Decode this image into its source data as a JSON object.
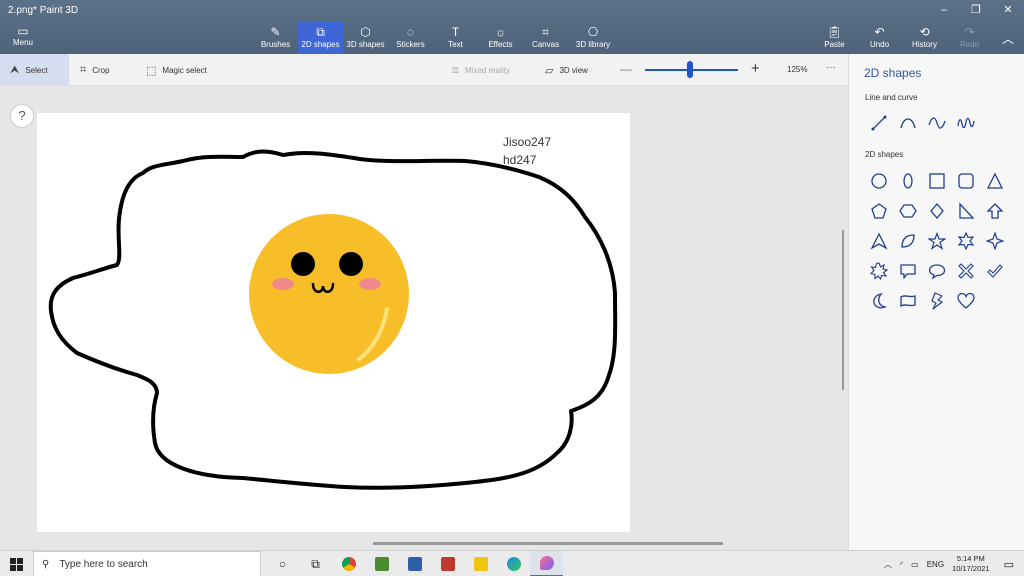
{
  "window": {
    "title": "2.png*   Paint 3D",
    "controls": [
      "–",
      "❐",
      "✕"
    ]
  },
  "ribbon": {
    "menu_label": "Menu",
    "tools": [
      {
        "label": "Brushes",
        "icon": "brush-icon"
      },
      {
        "label": "2D shapes",
        "icon": "2d-shapes-icon",
        "active": true
      },
      {
        "label": "3D shapes",
        "icon": "3d-shapes-icon"
      },
      {
        "label": "Stickers",
        "icon": "stickers-icon"
      },
      {
        "label": "Text",
        "icon": "text-icon"
      },
      {
        "label": "Effects",
        "icon": "effects-icon"
      },
      {
        "label": "Canvas",
        "icon": "canvas-icon"
      },
      {
        "label": "3D library",
        "icon": "3d-library-icon"
      }
    ],
    "right_tools": [
      {
        "label": "Paste",
        "icon": "paste-icon"
      },
      {
        "label": "Undo",
        "icon": "undo-icon"
      },
      {
        "label": "History",
        "icon": "history-icon"
      },
      {
        "label": "Redo",
        "icon": "redo-icon",
        "disabled": true
      }
    ]
  },
  "toolbar": {
    "select": "Select",
    "crop": "Crop",
    "magic_select": "Magic select",
    "mixed_reality": "Mixed reality",
    "view_3d": "3D view",
    "zoom_minus": "—",
    "zoom_plus": "+",
    "zoom_value": "125%",
    "zoom_fraction": 0.48,
    "more": "···"
  },
  "canvas": {
    "help": "?",
    "text_lines": [
      "Jisoo247",
      "hd247"
    ]
  },
  "panel": {
    "title": "2D shapes",
    "section_line": "Line and curve",
    "section_shapes": "2D shapes",
    "curves": [
      "line-shape-icon",
      "curve-shape-icon",
      "s-curve-shape-icon",
      "wave-curve-shape-icon"
    ],
    "shapes": [
      "circle-shape-icon",
      "ellipse-shape-icon",
      "square-shape-icon",
      "rounded-square-shape-icon",
      "triangle-shape-icon",
      "pentagon-shape-icon",
      "hexagon-shape-icon",
      "diamond-shape-icon",
      "right-triangle-shape-icon",
      "arrow-up-shape-icon",
      "outline-triangle-shape-icon",
      "leaf-shape-icon",
      "star5-shape-icon",
      "star6-shape-icon",
      "star4-shape-icon",
      "burst-shape-icon",
      "speech-bubble-shape-icon",
      "oval-bubble-shape-icon",
      "x-mark-shape-icon",
      "check-mark-shape-icon",
      "moon-shape-icon",
      "banner-shape-icon",
      "lightning-shape-icon",
      "heart-shape-icon"
    ]
  },
  "taskbar": {
    "search_placeholder": "Type here to search",
    "language": "ENG",
    "time": "5:14 PM",
    "date": "10/17/2021"
  },
  "colors": {
    "ribbon": "#52677d",
    "accent": "#3f66d6",
    "shape_stroke": "#1f3f8f",
    "yolk": "#f8be2a"
  }
}
